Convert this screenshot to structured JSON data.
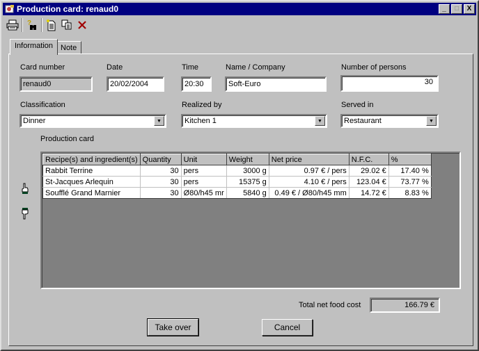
{
  "window": {
    "title": "Production card: renaud0",
    "controls": {
      "minimize": "_",
      "maximize": "□",
      "close": "X"
    }
  },
  "toolbar": {
    "items": [
      {
        "name": "print",
        "glyph": "🖶"
      },
      {
        "name": "search",
        "glyph": "?"
      },
      {
        "name": "new",
        "glyph": "🗋"
      },
      {
        "name": "copy",
        "glyph": "⎘"
      },
      {
        "name": "delete",
        "glyph": "✕"
      }
    ]
  },
  "tabs": [
    {
      "label": "Information",
      "active": true
    },
    {
      "label": "Note",
      "active": false
    }
  ],
  "form": {
    "card_number": {
      "label": "Card number",
      "value": "renaud0"
    },
    "date": {
      "label": "Date",
      "value": "20/02/2004"
    },
    "time": {
      "label": "Time",
      "value": "20:30"
    },
    "name_company": {
      "label": "Name / Company",
      "value": "Soft-Euro"
    },
    "number_of_persons": {
      "label": "Number of persons",
      "value": "30"
    },
    "classification": {
      "label": "Classification",
      "value": "Dinner"
    },
    "realized_by": {
      "label": "Realized by",
      "value": "Kitchen 1"
    },
    "served_in": {
      "label": "Served in",
      "value": "Restaurant"
    }
  },
  "production_card": {
    "label": "Production card",
    "columns": [
      "Recipe(s) and ingredient(s)",
      "Quantity",
      "Unit",
      "Weight",
      "Net price",
      "N.F.C.",
      "%"
    ],
    "rows": [
      [
        "Rabbit Terrine",
        "30",
        "pers",
        "3000 g",
        "0.97 € / pers",
        "29.02 €",
        "17.40 %"
      ],
      [
        "St-Jacques Arlequin",
        "30",
        "pers",
        "15375 g",
        "4.10 € / pers",
        "123.04 €",
        "73.77 %"
      ],
      [
        "Soufflé Grand Marnier",
        "30",
        "Ø80/h45 mr",
        "5840 g",
        "0.49 € / Ø80/h45 mm",
        "14.72 €",
        "8.83 %"
      ]
    ]
  },
  "totals": {
    "label": "Total net food cost",
    "value": "166.79 €"
  },
  "buttons": {
    "take_over": "Take over",
    "cancel": "Cancel"
  },
  "colors": {
    "titlebar": "#000080",
    "face": "#c0c0c0",
    "grid_empty": "#808080",
    "delete_icon": "#a00000"
  }
}
